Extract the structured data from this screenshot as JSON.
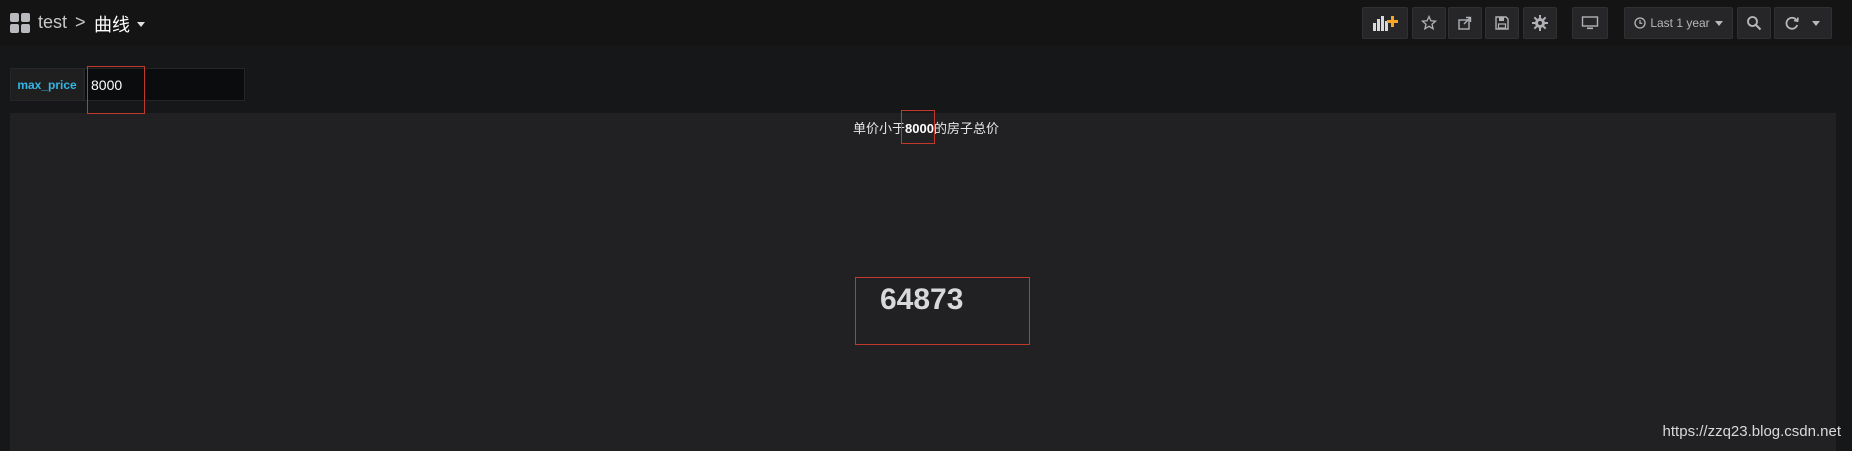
{
  "breadcrumb": {
    "parent": "test",
    "separator": ">",
    "current": "曲线"
  },
  "toolbar": {
    "add_panel_icon": "bar-chart-plus-icon",
    "star_icon": "star-icon",
    "share_icon": "share-icon",
    "save_icon": "save-icon",
    "settings_icon": "gear-icon",
    "tv_icon": "monitor-icon",
    "time_range_label": "Last 1 year",
    "zoom_icon": "zoom-out-icon",
    "refresh_icon": "refresh-icon"
  },
  "variable": {
    "name": "max_price",
    "value": "8000"
  },
  "panel": {
    "title_prefix": "单价小于",
    "title_value": "8000",
    "title_suffix": "的房子总价",
    "stat_value": "64873"
  },
  "watermark": "https://zzq23.blog.csdn.net",
  "colors": {
    "background": "#161719",
    "panel": "#212124",
    "variable_label": "#33b5e5",
    "add_panel_accent": "#f5a623",
    "annotation": "#c0392b"
  }
}
